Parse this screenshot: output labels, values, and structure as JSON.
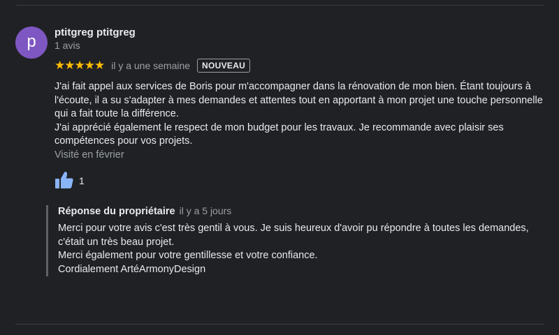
{
  "review": {
    "avatar_letter": "p",
    "avatar_color": "#7e57c2",
    "author_name": "ptitgreg ptitgreg",
    "author_meta": "1 avis",
    "stars": "★★★★★",
    "rating": 5,
    "star_color": "#fbbc04",
    "date": "il y a une semaine",
    "badge": "NOUVEAU",
    "text_lines": [
      "J'ai fait appel aux services de Boris pour m'accompagner dans la rénovation de mon bien. Étant toujours à l'écoute, il a su s'adapter à mes demandes et attentes tout en apportant à mon projet une touche personnelle qui a fait toute la différence.",
      "J'ai apprécié également le respect de mon budget pour les travaux. Je recommande avec plaisir ses compétences pour vos projets."
    ],
    "visited": "Visité en février",
    "likes": "1",
    "like_icon": "thumbs-up-icon",
    "like_color": "#8ab4f8"
  },
  "response": {
    "title": "Réponse du propriétaire",
    "date": "il y a 5 jours",
    "lines": [
      "Merci pour votre avis c'est très gentil à vous. Je suis heureux d'avoir pu répondre à toutes les demandes, c'était un très beau projet.",
      "Merci également pour votre gentillesse et votre confiance.",
      "Cordialement ArtéArmonyDesign"
    ]
  }
}
